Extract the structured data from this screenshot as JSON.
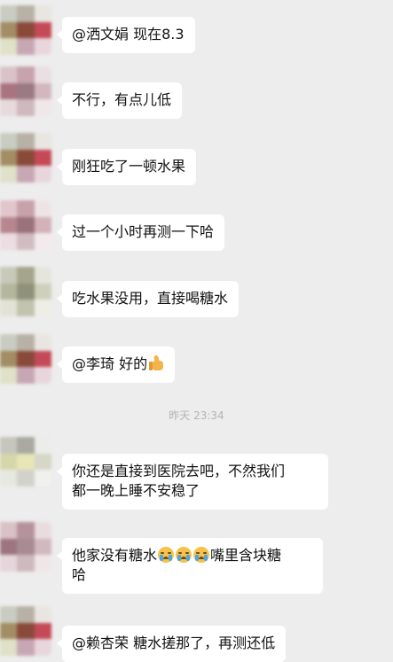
{
  "chat": {
    "messages": [
      {
        "text": "@洒文娟 现在8.3",
        "avatar_colors": [
          "#c9ccc2",
          "#b8b1a6",
          "#e9e5e1",
          "#a28d64",
          "#8a4a3a",
          "#c44a58",
          "#dfe1c8",
          "#c7a7b4",
          "#e8d6dc"
        ]
      },
      {
        "text": "不行，有点儿低",
        "avatar_colors": [
          "#d9c3c9",
          "#c7a3ad",
          "#eadfe2",
          "#a9737f",
          "#9a7a83",
          "#d4b6be",
          "#e6dadd",
          "#cfb8be",
          "#efe7e9"
        ]
      },
      {
        "text": "刚狂吃了一顿水果",
        "avatar_colors": [
          "#c9ccc2",
          "#b8b1a6",
          "#e9e5e1",
          "#a28d64",
          "#8a4a3a",
          "#c44a58",
          "#dfe1c8",
          "#c7a7b4",
          "#e8d6dc"
        ]
      },
      {
        "text": "过一个小时再测一下哈",
        "avatar_colors": [
          "#e1c6cc",
          "#c8a1aa",
          "#eee4e6",
          "#b78690",
          "#9a727b",
          "#d4b1b9",
          "#ebdde1",
          "#d0bcc1",
          "#f2eaec"
        ]
      },
      {
        "text": "吃水果没用，直接喝糖水",
        "avatar_colors": [
          "#c8c9b9",
          "#a4a58c",
          "#e5e5dc",
          "#b4b79d",
          "#8f917a",
          "#cfd0bc",
          "#e2e3d6",
          "#c2c3af",
          "#eeeee6"
        ]
      },
      {
        "text": "@李琦 好的",
        "avatar_colors": [
          "#c9ccc2",
          "#b8b1a6",
          "#e9e5e1",
          "#a28d64",
          "#8a4a3a",
          "#c44a58",
          "#dfe1c8",
          "#c7a7b4",
          "#e8d6dc"
        ]
      },
      {
        "text_line1": "你还是直接到医院去吧，不然我们",
        "text_line2": "都一晚上睡不安稳了",
        "avatar_colors": [
          "#c6c6bd",
          "#a9a9a1",
          "#ecece8",
          "#d5d6a9",
          "#e7e6b8",
          "#d6d6c9",
          "#e8e8e2",
          "#d2d2cb",
          "#f0f0ec"
        ]
      },
      {
        "text_part1": "他家没有糖水",
        "text_part2": "嘴里含块糖",
        "text_line2": "哈",
        "avatar_colors": [
          "#d8c1c7",
          "#b5929c",
          "#e9dcdf",
          "#9d7580",
          "#a88b93",
          "#d2b8bf",
          "#e4d6da",
          "#cdb9be",
          "#efe6e8"
        ]
      },
      {
        "text": "@赖杏荣 糖水搓那了，再测还低",
        "avatar_colors": [
          "#c9ccc2",
          "#b8b1a6",
          "#e9e5e1",
          "#a28d64",
          "#8a4a3a",
          "#c44a58",
          "#dfe1c8",
          "#c7a7b4",
          "#e8d6dc"
        ]
      }
    ],
    "timestamp": "昨天 23:34",
    "icons": {
      "thumbs_up": "thumbs-up-emoji",
      "crying": "crying-face-emoji"
    }
  }
}
